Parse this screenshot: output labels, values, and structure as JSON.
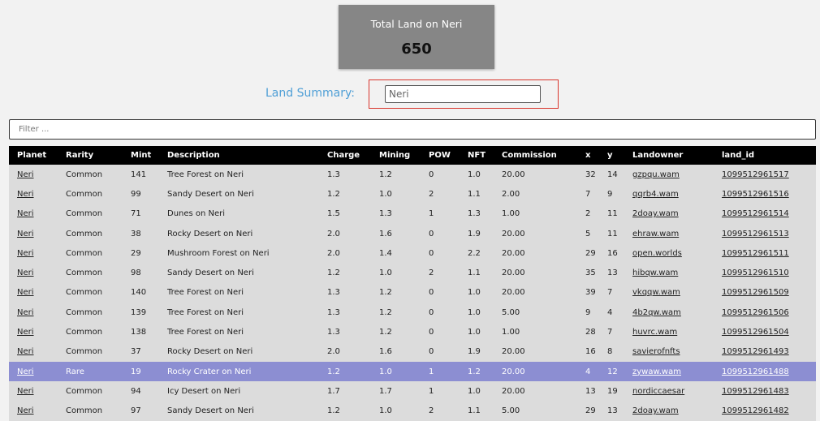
{
  "total_card": {
    "title": "Total Land on Neri",
    "value": "650"
  },
  "summary": {
    "label": "Land Summary:",
    "value": "Neri"
  },
  "filter": {
    "placeholder": "Filter ..."
  },
  "table": {
    "headers": [
      "Planet",
      "Rarity",
      "Mint",
      "Description",
      "Charge",
      "Mining",
      "POW",
      "NFT",
      "Commission",
      "x",
      "y",
      "Landowner",
      "land_id"
    ],
    "rows": [
      {
        "planet": "Neri",
        "rarity": "Common",
        "mint": "141",
        "description": "Tree Forest on Neri",
        "charge": "1.3",
        "mining": "1.2",
        "pow": "0",
        "nft": "1.0",
        "commission": "20.00",
        "x": "32",
        "y": "14",
        "landowner": "gzpqu.wam",
        "land_id": "1099512961517",
        "rare": false
      },
      {
        "planet": "Neri",
        "rarity": "Common",
        "mint": "99",
        "description": "Sandy Desert on Neri",
        "charge": "1.2",
        "mining": "1.0",
        "pow": "2",
        "nft": "1.1",
        "commission": "2.00",
        "x": "7",
        "y": "9",
        "landowner": "qqrb4.wam",
        "land_id": "1099512961516",
        "rare": false
      },
      {
        "planet": "Neri",
        "rarity": "Common",
        "mint": "71",
        "description": "Dunes on Neri",
        "charge": "1.5",
        "mining": "1.3",
        "pow": "1",
        "nft": "1.3",
        "commission": "1.00",
        "x": "2",
        "y": "11",
        "landowner": "2doay.wam",
        "land_id": "1099512961514",
        "rare": false
      },
      {
        "planet": "Neri",
        "rarity": "Common",
        "mint": "38",
        "description": "Rocky Desert on Neri",
        "charge": "2.0",
        "mining": "1.6",
        "pow": "0",
        "nft": "1.9",
        "commission": "20.00",
        "x": "5",
        "y": "11",
        "landowner": "ehraw.wam",
        "land_id": "1099512961513",
        "rare": false
      },
      {
        "planet": "Neri",
        "rarity": "Common",
        "mint": "29",
        "description": "Mushroom Forest on Neri",
        "charge": "2.0",
        "mining": "1.4",
        "pow": "0",
        "nft": "2.2",
        "commission": "20.00",
        "x": "29",
        "y": "16",
        "landowner": "open.worlds",
        "land_id": "1099512961511",
        "rare": false
      },
      {
        "planet": "Neri",
        "rarity": "Common",
        "mint": "98",
        "description": "Sandy Desert on Neri",
        "charge": "1.2",
        "mining": "1.0",
        "pow": "2",
        "nft": "1.1",
        "commission": "20.00",
        "x": "35",
        "y": "13",
        "landowner": "hibqw.wam",
        "land_id": "1099512961510",
        "rare": false
      },
      {
        "planet": "Neri",
        "rarity": "Common",
        "mint": "140",
        "description": "Tree Forest on Neri",
        "charge": "1.3",
        "mining": "1.2",
        "pow": "0",
        "nft": "1.0",
        "commission": "20.00",
        "x": "39",
        "y": "7",
        "landowner": "vkqqw.wam",
        "land_id": "1099512961509",
        "rare": false
      },
      {
        "planet": "Neri",
        "rarity": "Common",
        "mint": "139",
        "description": "Tree Forest on Neri",
        "charge": "1.3",
        "mining": "1.2",
        "pow": "0",
        "nft": "1.0",
        "commission": "5.00",
        "x": "9",
        "y": "4",
        "landowner": "4b2qw.wam",
        "land_id": "1099512961506",
        "rare": false
      },
      {
        "planet": "Neri",
        "rarity": "Common",
        "mint": "138",
        "description": "Tree Forest on Neri",
        "charge": "1.3",
        "mining": "1.2",
        "pow": "0",
        "nft": "1.0",
        "commission": "1.00",
        "x": "28",
        "y": "7",
        "landowner": "huvrc.wam",
        "land_id": "1099512961504",
        "rare": false
      },
      {
        "planet": "Neri",
        "rarity": "Common",
        "mint": "37",
        "description": "Rocky Desert on Neri",
        "charge": "2.0",
        "mining": "1.6",
        "pow": "0",
        "nft": "1.9",
        "commission": "20.00",
        "x": "16",
        "y": "8",
        "landowner": "savierofnfts",
        "land_id": "1099512961493",
        "rare": false
      },
      {
        "planet": "Neri",
        "rarity": "Rare",
        "mint": "19",
        "description": "Rocky Crater on Neri",
        "charge": "1.2",
        "mining": "1.0",
        "pow": "1",
        "nft": "1.2",
        "commission": "20.00",
        "x": "4",
        "y": "12",
        "landowner": "zywaw.wam",
        "land_id": "1099512961488",
        "rare": true
      },
      {
        "planet": "Neri",
        "rarity": "Common",
        "mint": "94",
        "description": "Icy Desert on Neri",
        "charge": "1.7",
        "mining": "1.7",
        "pow": "1",
        "nft": "1.0",
        "commission": "20.00",
        "x": "13",
        "y": "19",
        "landowner": "nordiccaesar",
        "land_id": "1099512961483",
        "rare": false
      },
      {
        "planet": "Neri",
        "rarity": "Common",
        "mint": "97",
        "description": "Sandy Desert on Neri",
        "charge": "1.2",
        "mining": "1.0",
        "pow": "2",
        "nft": "1.1",
        "commission": "5.00",
        "x": "29",
        "y": "13",
        "landowner": "2doay.wam",
        "land_id": "1099512961482",
        "rare": false
      }
    ]
  },
  "colors": {
    "header_bg": "#000000",
    "row_bg": "#dcdcdc",
    "rare_row_bg": "#8c8ed2",
    "card_bg": "#868686",
    "highlight_box": "#d9342b",
    "summary_label": "#4f9fd6"
  }
}
